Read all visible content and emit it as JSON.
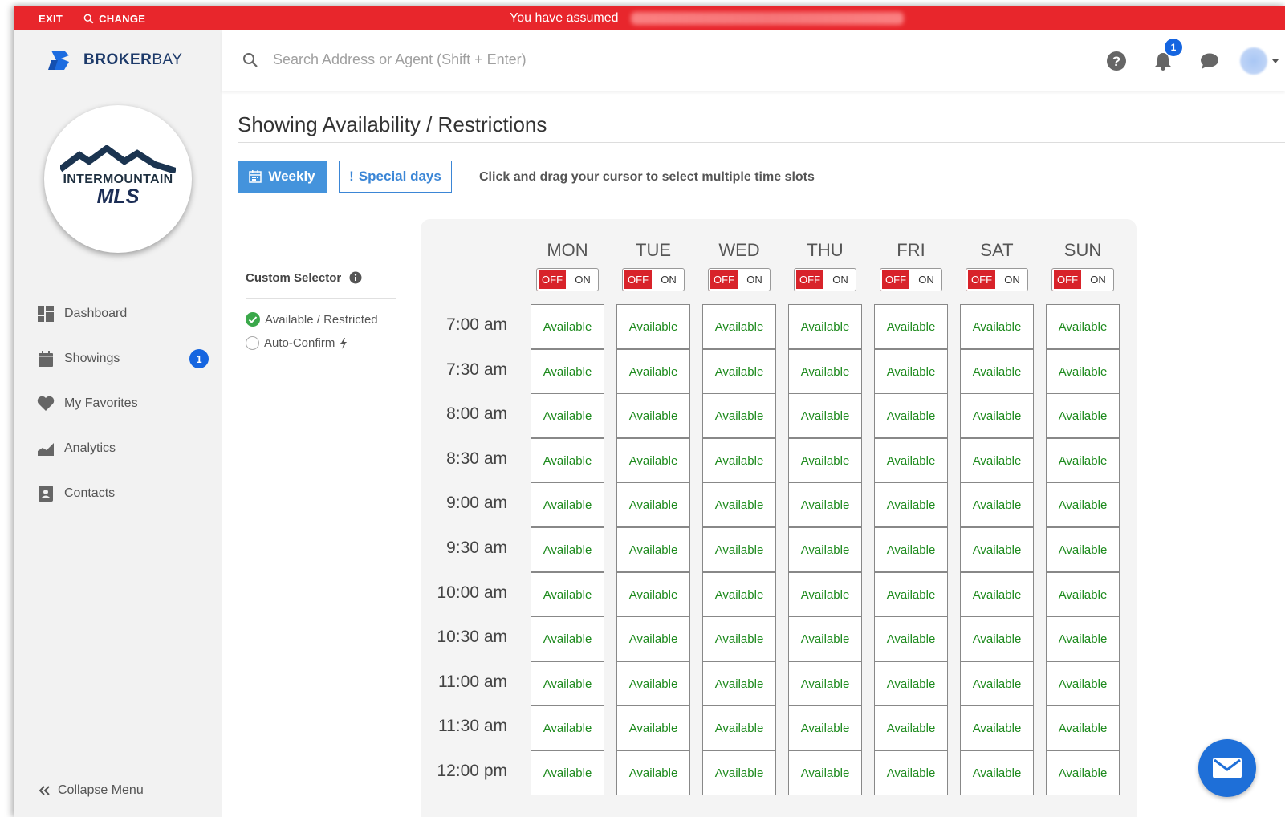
{
  "topbar": {
    "exit_label": "EXIT",
    "change_label": "CHANGE",
    "assumed_text": "You have assumed"
  },
  "brand": {
    "name_bold": "BROKER",
    "name_light": "BAY",
    "mls_top": "INTERMOUNTAIN",
    "mls_bottom": "MLS"
  },
  "sidebar": {
    "items": [
      {
        "label": "Dashboard",
        "icon": "dashboard-icon"
      },
      {
        "label": "Showings",
        "icon": "calendar-icon",
        "badge": "1"
      },
      {
        "label": "My Favorites",
        "icon": "heart-icon"
      },
      {
        "label": "Analytics",
        "icon": "chart-icon"
      },
      {
        "label": "Contacts",
        "icon": "contact-card-icon"
      }
    ],
    "collapse_label": "Collapse Menu"
  },
  "header": {
    "search_placeholder": "Search Address or Agent (Shift + Enter)",
    "notification_count": "1"
  },
  "main": {
    "title": "Showing Availability / Restrictions",
    "weekly_label": "Weekly",
    "special_days_label": "Special days",
    "hint": "Click and drag your cursor to select multiple time slots",
    "custom_selector_label": "Custom Selector",
    "option_available": "Available / Restricted",
    "option_autoconfirm": "Auto-Confirm"
  },
  "schedule": {
    "days": [
      "MON",
      "TUE",
      "WED",
      "THU",
      "FRI",
      "SAT",
      "SUN"
    ],
    "toggle_off": "OFF",
    "toggle_on": "ON",
    "times": [
      "7:00 am",
      "7:30 am",
      "8:00 am",
      "8:30 am",
      "9:00 am",
      "9:30 am",
      "10:00 am",
      "10:30 am",
      "11:00 am",
      "11:30 am",
      "12:00 pm"
    ],
    "cell_label": "Available"
  },
  "colors": {
    "accent_red": "#e8262c",
    "primary_blue": "#4493dc",
    "available_green": "#1d8a1d"
  }
}
